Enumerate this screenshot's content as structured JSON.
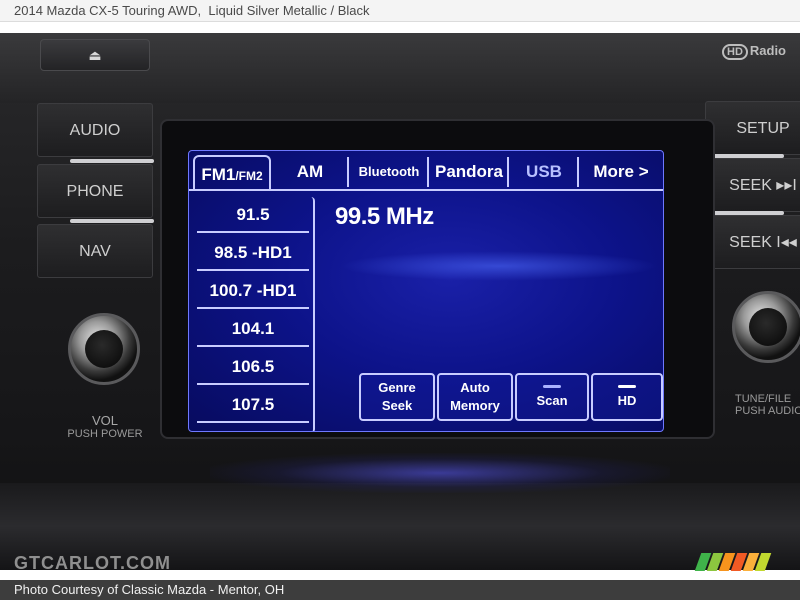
{
  "caption": {
    "vehicle": "2014 Mazda CX-5 Touring AWD,",
    "color": "Liquid Silver Metallic / Black"
  },
  "head_unit": {
    "eject_icon": "eject-icon",
    "hd_logo": {
      "badge": "HD",
      "text": "Radio"
    },
    "left_buttons": [
      "AUDIO",
      "PHONE",
      "NAV"
    ],
    "right_buttons": [
      "SETUP",
      "SEEK ▸▸I",
      "SEEK I◂◂"
    ],
    "vol_label": "VOL",
    "vol_push": "PUSH POWER",
    "tune_label": "TUNE/FILE",
    "tune_push": "PUSH AUDIO CTRL"
  },
  "screen": {
    "tabs": [
      {
        "main": "FM1",
        "sub": "/FM2",
        "active": true
      },
      {
        "main": "AM"
      },
      {
        "main": "Bluetooth"
      },
      {
        "main": "Pandora"
      },
      {
        "main": "USB"
      },
      {
        "main": "More >"
      }
    ],
    "presets": [
      "91.5",
      "98.5 -HD1",
      "100.7 -HD1",
      "104.1",
      "106.5",
      "107.5"
    ],
    "current_frequency": "99.5 MHz",
    "softkeys": [
      {
        "line1": "Genre",
        "line2": "Seek"
      },
      {
        "line1": "Auto",
        "line2": "Memory"
      },
      {
        "line1": "",
        "line2": "Scan"
      },
      {
        "line1": "",
        "line2": "HD",
        "indicator_on": true
      }
    ]
  },
  "watermark": "GTCARLOT.COM",
  "stripe_colors": [
    "#3fb34a",
    "#8cc63f",
    "#f7941d",
    "#f15a24",
    "#fbb03b",
    "#c1d82f"
  ],
  "footer": "Photo Courtesy of Classic Mazda - Mentor, OH"
}
